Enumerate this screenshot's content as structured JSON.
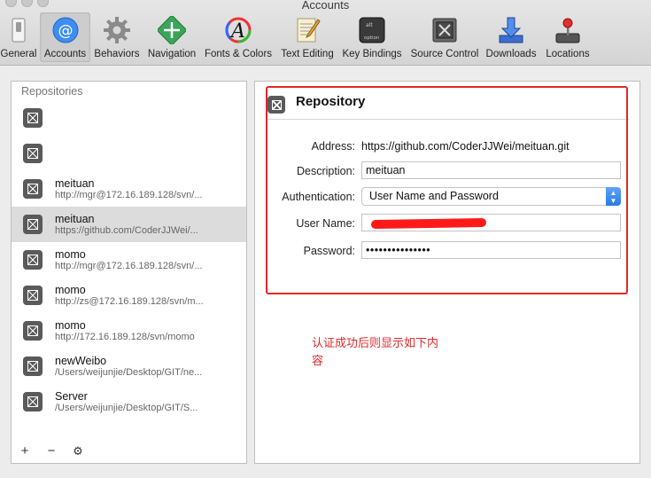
{
  "window": {
    "title": "Accounts"
  },
  "toolbar": {
    "items": [
      {
        "label": "General",
        "icon": "general-switch-icon"
      },
      {
        "label": "Accounts",
        "icon": "at-sign-icon"
      },
      {
        "label": "Behaviors",
        "icon": "gear-icon"
      },
      {
        "label": "Navigation",
        "icon": "navigation-arrows-icon"
      },
      {
        "label": "Fonts & Colors",
        "icon": "font-color-wheel-icon"
      },
      {
        "label": "Text Editing",
        "icon": "text-editing-pencil-icon"
      },
      {
        "label": "Key Bindings",
        "icon": "option-key-icon"
      },
      {
        "label": "Source Control",
        "icon": "source-control-safe-icon"
      },
      {
        "label": "Downloads",
        "icon": "download-tray-icon"
      },
      {
        "label": "Locations",
        "icon": "joystick-icon"
      }
    ],
    "active_index": 1
  },
  "repositories": {
    "header": "Repositories",
    "items": [
      {
        "name": "",
        "url": ""
      },
      {
        "name": "",
        "url": ""
      },
      {
        "name": "meituan",
        "url": "http://mgr@172.16.189.128/svn/..."
      },
      {
        "name": "meituan",
        "url": "https://github.com/CoderJJWei/..."
      },
      {
        "name": "momo",
        "url": "http://mgr@172.16.189.128/svn/..."
      },
      {
        "name": "momo",
        "url": "http://zs@172.16.189.128/svn/m..."
      },
      {
        "name": "momo",
        "url": "http://172.16.189.128/svn/momo"
      },
      {
        "name": "newWeibo",
        "url": "/Users/weijunjie/Desktop/GIT/ne..."
      },
      {
        "name": "Server",
        "url": "/Users/weijunjie/Desktop/GIT/S..."
      }
    ],
    "selected_index": 3,
    "footer": {
      "add": "+",
      "remove": "−",
      "settings": "⚙"
    }
  },
  "detail": {
    "title": "Repository",
    "address_label": "Address:",
    "address_value": "https://github.com/CoderJJWei/meituan.git",
    "description_label": "Description:",
    "description_value": "meituan",
    "authentication_label": "Authentication:",
    "authentication_value": "User Name and Password",
    "username_label": "User Name:",
    "username_value": "",
    "password_label": "Password:",
    "password_value": "•••••••••••••••"
  },
  "annotation": {
    "text": "认证成功后则显示如下内容",
    "color": "#e0282c"
  }
}
